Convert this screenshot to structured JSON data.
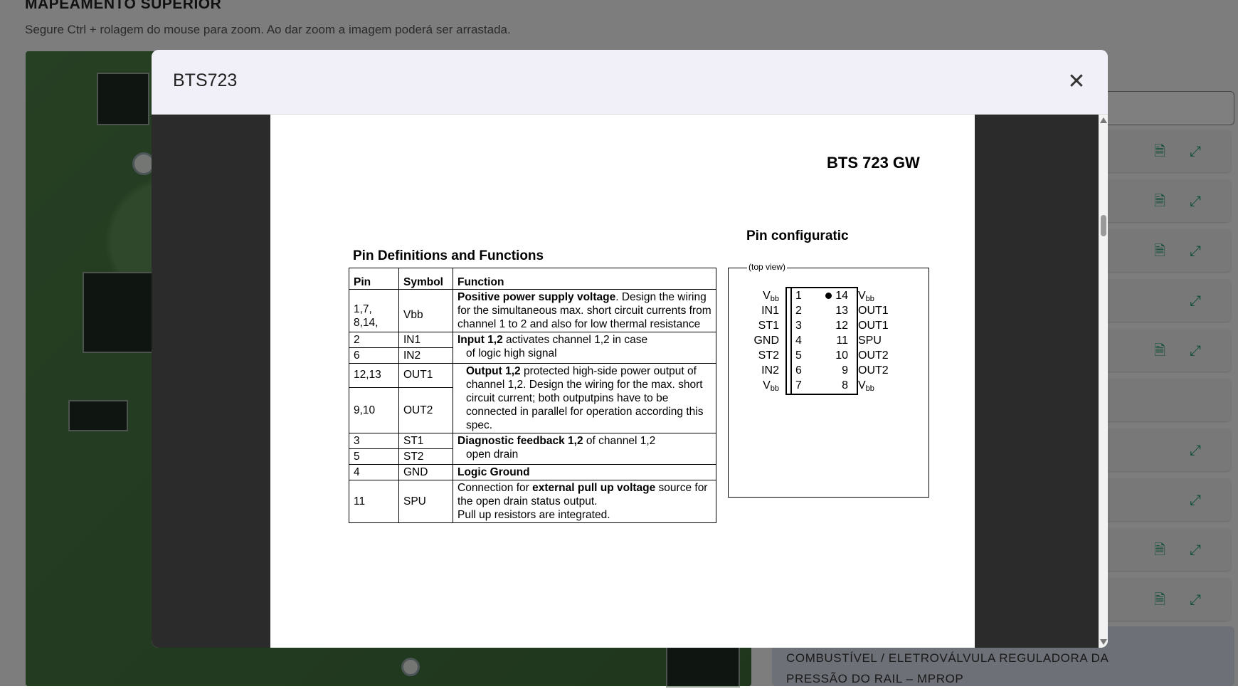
{
  "background": {
    "section_title": "MAPEAMENTO SUPERIOR",
    "hint": "Segure Ctrl + rolagem do mouse para zoom. Ao dar zoom a imagem poderá ser arrastada.",
    "bottom_item_text": "COMBUSTÍVEL / ELETROVÁLVULA REGULADORA DA PRESSÃO DO RAIL – MPROP",
    "row_icons": [
      "document-icon",
      "expand-icon"
    ]
  },
  "modal": {
    "title": "BTS723",
    "close_symbol": "✕"
  },
  "pdf": {
    "doc_heading": "BTS 723 GW",
    "pin_def_title": "Pin Definitions and Functions",
    "pin_conf_title": "Pin configuratic",
    "top_view": "(top view)",
    "table_headers": [
      "Pin",
      "Symbol",
      "Function"
    ],
    "rows": [
      {
        "pin": "1,7, 8,14,",
        "symbol": "Vbb",
        "func_bold": "Positive power supply voltage",
        "func_rest": ". Design the wiring for the simultaneous max. short circuit currents from channel 1 to 2 and also for low thermal resistance"
      },
      {
        "pin": "2",
        "symbol": "IN1",
        "func_bold": "Input 1,2",
        "func_rest": " activates channel 1,2 in case"
      },
      {
        "pin": "6",
        "symbol": "IN2",
        "func_rest": "of logic high signal"
      },
      {
        "pin": "12,13",
        "symbol": "OUT1",
        "func_bold": "Output 1,2",
        "func_rest": " protected high-side power output of channel 1,2. Design the wiring for the max. short circuit current; both outputpins have to be connected in parallel for operation according this spec."
      },
      {
        "pin": "9,10",
        "symbol": "OUT2"
      },
      {
        "pin": "3",
        "symbol": "ST1",
        "func_bold": "Diagnostic feedback 1,2",
        "func_rest": " of channel 1,2"
      },
      {
        "pin": "5",
        "symbol": "ST2",
        "func_rest": "open drain"
      },
      {
        "pin": "4",
        "symbol": "GND",
        "func_bold": "Logic Ground"
      },
      {
        "pin": "11",
        "symbol": "SPU",
        "func_pre": "Connection for ",
        "func_bold": "external pull up voltage",
        "func_rest": " source for the open drain status output.",
        "func_extra": "Pull up resistors are integrated."
      }
    ],
    "pinout": [
      {
        "l_label": "V",
        "l_sub": "bb",
        "l_num": "1",
        "r_num": "14",
        "r_label": "V",
        "r_sub": "bb"
      },
      {
        "l_label": "IN1",
        "l_num": "2",
        "r_num": "13",
        "r_label": "OUT1"
      },
      {
        "l_label": "ST1",
        "l_num": "3",
        "r_num": "12",
        "r_label": "OUT1"
      },
      {
        "l_label": "GND",
        "l_num": "4",
        "r_num": "11",
        "r_label": "SPU"
      },
      {
        "l_label": "ST2",
        "l_num": "5",
        "r_num": "10",
        "r_label": "OUT2"
      },
      {
        "l_label": "IN2",
        "l_num": "6",
        "r_num": "9",
        "r_label": "OUT2"
      },
      {
        "l_label": "V",
        "l_sub": "bb",
        "l_num": "7",
        "r_num": "8",
        "r_label": "V",
        "r_sub": "bb"
      }
    ]
  }
}
